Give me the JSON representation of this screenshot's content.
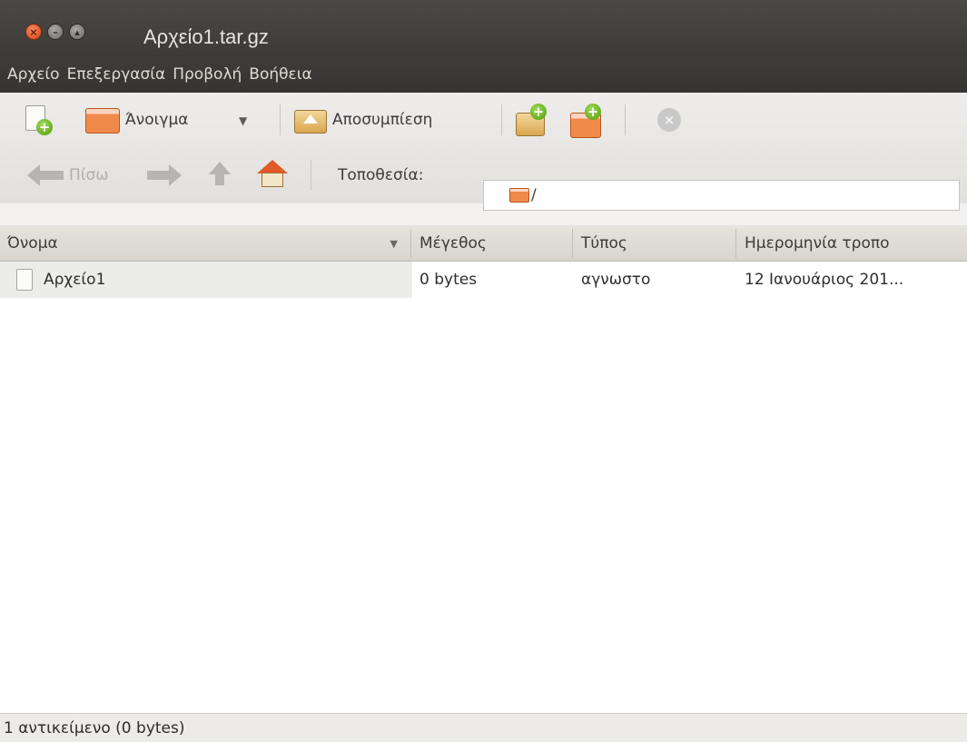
{
  "window": {
    "title": "Αρχείο1.tar.gz"
  },
  "menu": {
    "items": [
      "Αρχείο",
      "Επεξεργασία",
      "Προβολή",
      "Βοήθεια"
    ]
  },
  "toolbar": {
    "open_label": "Άνοιγμα",
    "open_dropdown_glyph": "▼",
    "extract_label": "Αποσυμπίεση"
  },
  "nav": {
    "back_label": "Πίσω",
    "location_label": "Τοποθεσία:",
    "location_value": "/"
  },
  "table": {
    "headers": [
      "Όνομα",
      "Μέγεθος",
      "Τύπος",
      "Ημερομηνία τροπο"
    ],
    "sort_indicator": "▼",
    "rows": [
      {
        "name": "Αρχείο1",
        "size": "0 bytes",
        "type": "αγνωστο",
        "date": "12 Ιανουάριος 201..."
      }
    ]
  },
  "status": {
    "text": "1 αντικείμενο (0 bytes)"
  },
  "colors": {
    "accent": "#dd4814",
    "titlebar": "#3c3b37",
    "window_bg": "#f2f1f0"
  }
}
